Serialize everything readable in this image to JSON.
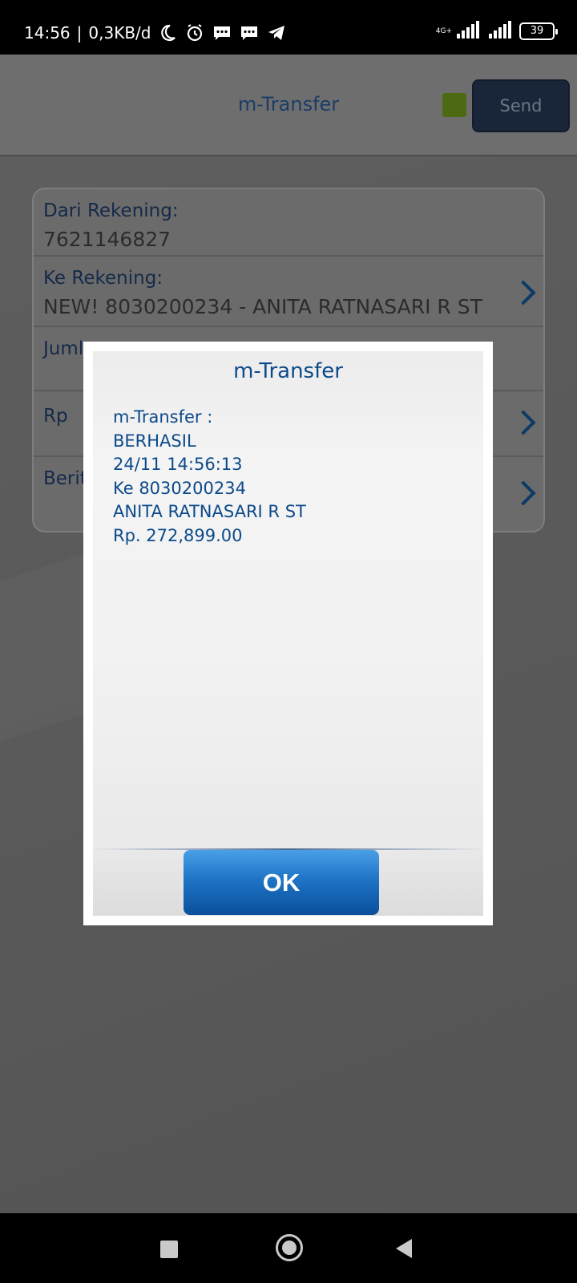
{
  "status_bar": {
    "time": "14:56",
    "network_speed": "0,3KB/d",
    "network_type": "4G+",
    "battery": "39"
  },
  "header": {
    "title": "m-Transfer",
    "send_label": "Send"
  },
  "form": {
    "rows": [
      {
        "label": "Dari Rekening:",
        "value": "7621146827"
      },
      {
        "label": "Ke Rekening:",
        "value": "NEW! 8030200234 - ANITA RATNASARI R ST"
      },
      {
        "label": "Juml",
        "value": ""
      },
      {
        "label": "Rp",
        "value": ""
      },
      {
        "label": "Berit",
        "value": ""
      }
    ]
  },
  "dialog": {
    "title": "m-Transfer",
    "lines": [
      "m-Transfer :",
      "BERHASIL",
      "24/11 14:56:13",
      "Ke 8030200234",
      "ANITA RATNASARI R ST",
      "Rp. 272,899.00"
    ],
    "ok_label": "OK"
  },
  "colors": {
    "accent_blue": "#0c4a8a",
    "ok_button": "#1f74c6",
    "led_green": "#4d6a12"
  }
}
